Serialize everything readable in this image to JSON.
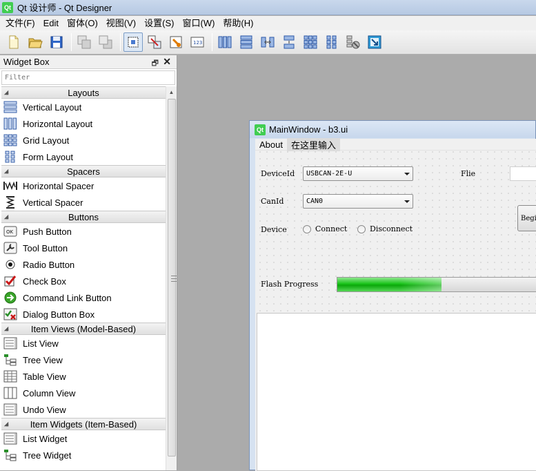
{
  "app": {
    "title": "Qt 设计师 - Qt Designer",
    "logo": "Qt"
  },
  "menubar": [
    "文件(F)",
    "Edit",
    "窗体(O)",
    "视图(V)",
    "设置(S)",
    "窗口(W)",
    "帮助(H)"
  ],
  "toolbar_icons": [
    "new-file-icon",
    "open-folder-icon",
    "save-icon",
    "send-to-back-icon",
    "bring-to-front-icon",
    "edit-widgets-icon",
    "edit-signals-slots-icon",
    "edit-buddies-icon",
    "edit-tab-order-icon",
    "layout-horizontal-icon",
    "layout-vertical-icon",
    "layout-horizontal-splitter-icon",
    "layout-vertical-splitter-icon",
    "layout-grid-icon",
    "layout-form-icon",
    "break-layout-icon",
    "adjust-size-icon"
  ],
  "widget_box": {
    "title": "Widget Box",
    "filter_placeholder": "Filter",
    "categories": [
      {
        "name": "Layouts",
        "items": [
          {
            "label": "Vertical Layout",
            "icon": "vertical-layout-icon"
          },
          {
            "label": "Horizontal Layout",
            "icon": "horizontal-layout-icon"
          },
          {
            "label": "Grid Layout",
            "icon": "grid-layout-icon"
          },
          {
            "label": "Form Layout",
            "icon": "form-layout-icon"
          }
        ]
      },
      {
        "name": "Spacers",
        "items": [
          {
            "label": "Horizontal Spacer",
            "icon": "horizontal-spacer-icon"
          },
          {
            "label": "Vertical Spacer",
            "icon": "vertical-spacer-icon"
          }
        ]
      },
      {
        "name": "Buttons",
        "items": [
          {
            "label": "Push Button",
            "icon": "push-button-icon"
          },
          {
            "label": "Tool Button",
            "icon": "tool-button-icon"
          },
          {
            "label": "Radio Button",
            "icon": "radio-button-icon"
          },
          {
            "label": "Check Box",
            "icon": "check-box-icon"
          },
          {
            "label": "Command Link Button",
            "icon": "command-link-icon"
          },
          {
            "label": "Dialog Button Box",
            "icon": "dialog-button-box-icon"
          }
        ]
      },
      {
        "name": "Item Views (Model-Based)",
        "items": [
          {
            "label": "List View",
            "icon": "list-view-icon"
          },
          {
            "label": "Tree View",
            "icon": "tree-view-icon"
          },
          {
            "label": "Table View",
            "icon": "table-view-icon"
          },
          {
            "label": "Column View",
            "icon": "column-view-icon"
          },
          {
            "label": "Undo View",
            "icon": "undo-view-icon"
          }
        ]
      },
      {
        "name": "Item Widgets (Item-Based)",
        "items": [
          {
            "label": "List Widget",
            "icon": "list-widget-icon"
          },
          {
            "label": "Tree Widget",
            "icon": "tree-widget-icon"
          }
        ]
      }
    ]
  },
  "form_window": {
    "title": "MainWindow - b3.ui",
    "menu": [
      "About",
      "在这里输入"
    ],
    "device_id_label": "DeviceId",
    "device_id_value": "USBCAN-2E-U",
    "flie_label": "Flie",
    "can_id_label": "CanId",
    "can_id_value": "CAN0",
    "device_label": "Device",
    "connect_label": "Connect",
    "disconnect_label": "Disconnect",
    "begin_button": "Begi",
    "flash_progress_label": "Flash Progress",
    "flash_progress": 0.52
  },
  "colors": {
    "qt_green": "#41cd52",
    "progress_green": "#19c319"
  }
}
